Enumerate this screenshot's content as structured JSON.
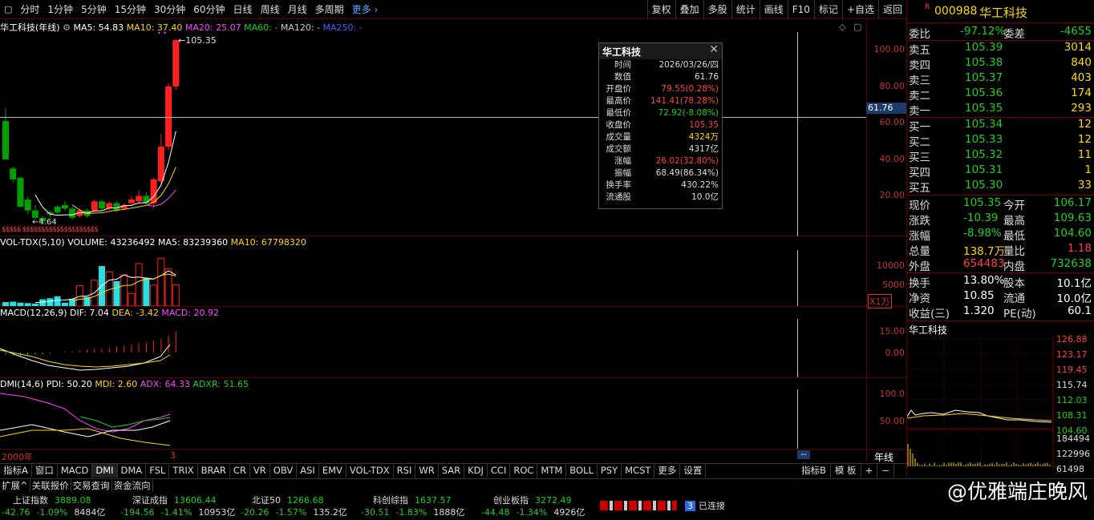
{
  "toolbar": {
    "menu_icon": "square-icon",
    "periods": [
      "分时",
      "1分钟",
      "5分钟",
      "15分钟",
      "30分钟",
      "60分钟",
      "日线",
      "周线",
      "月线",
      "多周期"
    ],
    "more_label": "更多",
    "tools": [
      "复权",
      "叠加",
      "多股",
      "统计",
      "画线",
      "F10",
      "标记",
      "+自选",
      "返回"
    ]
  },
  "price_panel": {
    "title": "华工科技(年线)",
    "ma5": "MA5: 54.83",
    "ma10": "MA10: 37.40",
    "ma20": "MA20: 25.07",
    "ma60": "MA60: -",
    "ma120": "MA120: -",
    "ma250": "MA250: -",
    "high_label": "105.35",
    "low_label": "4.64",
    "cursor_value": "61.76",
    "yticks": [
      "100.00",
      "80.00",
      "60.00",
      "40.00",
      "20.00"
    ],
    "dollar_marks": "$$$$$  $$$$$$$$$$$$$$$$$$$$"
  },
  "vol_panel": {
    "title": "VOL-TDX(5,10)",
    "volume": "VOLUME: 43236492",
    "ma5": "MA5: 83239360",
    "ma10": "MA10: 67798320",
    "yticks": [
      "10000",
      "5000"
    ],
    "unit": "X1万"
  },
  "macd_panel": {
    "title": "MACD(12,26,9)",
    "dif": "DIF: 7.04",
    "dea": "DEA: -3.42",
    "macd": "MACD: 20.92",
    "yticks": [
      "15.00",
      "0.00"
    ]
  },
  "dmi_panel": {
    "title": "DMI(14,6)",
    "pdi": "PDI: 50.20",
    "mdi": "MDI: 2.60",
    "adx": "ADX: 64.33",
    "adxr": "ADXR: 51.65",
    "yticks": [
      "100.0",
      "50.00"
    ]
  },
  "x_axis": {
    "start": "2000年",
    "mark": "3",
    "cursor": "--",
    "period_label": "年线"
  },
  "popup": {
    "title": "华工科技",
    "rows": [
      {
        "k": "时间",
        "v": "2026/03/26/四",
        "c": "#ddd"
      },
      {
        "k": "数值",
        "v": "61.76",
        "c": "#ddd"
      },
      {
        "k": "开盘价",
        "v": "79.55(0.28%)",
        "c": "#ff4040"
      },
      {
        "k": "最高价",
        "v": "141.41(78.28%)",
        "c": "#ff4040"
      },
      {
        "k": "最低价",
        "v": "72.92(-8.08%)",
        "c": "#1ed11e"
      },
      {
        "k": "收盘价",
        "v": "105.35",
        "c": "#ff4040"
      },
      {
        "k": "成交量",
        "v": "4324万",
        "c": "#ffd800"
      },
      {
        "k": "成交额",
        "v": "4317亿",
        "c": "#ddd"
      },
      {
        "k": "涨幅",
        "v": "26.02(32.80%)",
        "c": "#ff4040"
      },
      {
        "k": "振幅",
        "v": "68.49(86.34%)",
        "c": "#ddd"
      },
      {
        "k": "换手率",
        "v": "430.22%",
        "c": "#ddd"
      },
      {
        "k": "流通股",
        "v": "10.0亿",
        "c": "#ddd"
      }
    ]
  },
  "indicator_tabs": [
    "指标A",
    "窗口",
    "MACD",
    "DMI",
    "DMA",
    "FSL",
    "TRIX",
    "BRAR",
    "CR",
    "VR",
    "OBV",
    "ASI",
    "EMV",
    "VOL-TDX",
    "RSI",
    "WR",
    "SAR",
    "KDJ",
    "CCI",
    "ROC",
    "MTM",
    "BOLL",
    "PSY",
    "MCST",
    "更多",
    "设置"
  ],
  "right_tabs": [
    "指标B",
    "模 板",
    "+",
    "−"
  ],
  "sub_tabs": [
    "扩展^",
    "关联报价",
    "交易查询",
    "资金流向"
  ],
  "indices": [
    {
      "name": "上证指数",
      "value": "3889.08",
      "chg": "-42.76",
      "pct": "-1.09%",
      "amt": "8484亿"
    },
    {
      "name": "深证成指",
      "value": "13606.44",
      "chg": "-194.56",
      "pct": "-1.41%",
      "amt": "10953亿"
    },
    {
      "name": "北证50",
      "value": "1266.68",
      "chg": "-20.26",
      "pct": "-1.57%",
      "amt": "135.2亿"
    },
    {
      "name": "科创综指",
      "value": "1637.57",
      "chg": "-30.51",
      "pct": "-1.83%",
      "amt": "1888亿"
    },
    {
      "name": "创业板指",
      "value": "3272.49",
      "chg": "-44.48",
      "pct": "-1.34%",
      "amt": "4926亿"
    }
  ],
  "connection": {
    "num": "3",
    "label": "已连接"
  },
  "watermark": "@优雅端庄晚风",
  "quote": {
    "badge": "R",
    "code": "000988",
    "name": "华工科技",
    "weibi_label": "委比",
    "weibi": "-97.12%",
    "weicha_label": "委差",
    "weicha": "-4655",
    "asks": [
      {
        "label": "卖五",
        "price": "105.39",
        "vol": "3014"
      },
      {
        "label": "卖四",
        "price": "105.38",
        "vol": "840"
      },
      {
        "label": "卖三",
        "price": "105.37",
        "vol": "403"
      },
      {
        "label": "卖二",
        "price": "105.36",
        "vol": "174"
      },
      {
        "label": "卖一",
        "price": "105.35",
        "vol": "293"
      }
    ],
    "bids": [
      {
        "label": "买一",
        "price": "105.34",
        "vol": "12"
      },
      {
        "label": "买二",
        "price": "105.33",
        "vol": "12"
      },
      {
        "label": "买三",
        "price": "105.32",
        "vol": "11"
      },
      {
        "label": "买四",
        "price": "105.31",
        "vol": "1"
      },
      {
        "label": "买五",
        "price": "105.30",
        "vol": "33"
      }
    ],
    "stats": [
      {
        "l1": "现价",
        "v1": "105.35",
        "c1": "#1ed11e",
        "l2": "今开",
        "v2": "106.17",
        "c2": "#1ed11e"
      },
      {
        "l1": "涨跌",
        "v1": "-10.39",
        "c1": "#1ed11e",
        "l2": "最高",
        "v2": "109.63",
        "c2": "#1ed11e"
      },
      {
        "l1": "涨幅",
        "v1": "-8.98%",
        "c1": "#1ed11e",
        "l2": "最低",
        "v2": "104.60",
        "c2": "#1ed11e"
      },
      {
        "l1": "总量",
        "v1": "138.7万",
        "c1": "#ffd800",
        "l2": "量比",
        "v2": "1.18",
        "c2": "#ff4040"
      },
      {
        "l1": "外盘",
        "v1": "654483",
        "c1": "#ff4040",
        "l2": "内盘",
        "v2": "732638",
        "c2": "#1ed11e"
      }
    ],
    "stats2": [
      {
        "l1": "换手",
        "v1": "13.80%",
        "l2": "股本",
        "v2": "10.1亿"
      },
      {
        "l1": "净资",
        "v1": "10.85",
        "l2": "流通",
        "v2": "10.0亿"
      },
      {
        "l1": "收益(三)",
        "v1": "1.320",
        "l2": "PE(动)",
        "v2": "60.1"
      }
    ],
    "mini_title": "华工科技",
    "mini_yticks": [
      {
        "v": "126.88",
        "c": "#ff4040"
      },
      {
        "v": "123.17",
        "c": "#ff4040"
      },
      {
        "v": "119.45",
        "c": "#ff4040"
      },
      {
        "v": "115.74",
        "c": "#ddd"
      },
      {
        "v": "112.03",
        "c": "#1ed11e"
      },
      {
        "v": "108.31",
        "c": "#1ed11e"
      },
      {
        "v": "104.60",
        "c": "#1ed11e"
      }
    ],
    "mini_vol": [
      "184494",
      "122996",
      "61498"
    ]
  },
  "chart_data": {
    "type": "candlestick",
    "candles": [
      {
        "o": 61,
        "h": 68,
        "l": 40,
        "c": 40
      },
      {
        "o": 35,
        "h": 36,
        "l": 27,
        "c": 29
      },
      {
        "o": 30,
        "h": 30,
        "l": 14,
        "c": 14
      },
      {
        "o": 18,
        "h": 20,
        "l": 10,
        "c": 12
      },
      {
        "o": 12,
        "h": 15,
        "l": 7,
        "c": 8
      },
      {
        "o": 8,
        "h": 9,
        "l": 4.64,
        "c": 6
      },
      {
        "o": 11,
        "h": 12,
        "l": 8,
        "c": 10
      },
      {
        "o": 14,
        "h": 15,
        "l": 10,
        "c": 11
      },
      {
        "o": 15,
        "h": 17,
        "l": 12,
        "c": 13
      },
      {
        "o": 13,
        "h": 14,
        "l": 7,
        "c": 8
      },
      {
        "o": 9,
        "h": 13,
        "l": 8,
        "c": 12
      },
      {
        "o": 12,
        "h": 13,
        "l": 8,
        "c": 9
      },
      {
        "o": 12,
        "h": 18,
        "l": 11,
        "c": 17
      },
      {
        "o": 17,
        "h": 18,
        "l": 12,
        "c": 13
      },
      {
        "o": 13,
        "h": 17,
        "l": 12,
        "c": 16
      },
      {
        "o": 16,
        "h": 17,
        "l": 11,
        "c": 12
      },
      {
        "o": 13,
        "h": 16,
        "l": 12,
        "c": 15
      },
      {
        "o": 16,
        "h": 20,
        "l": 15,
        "c": 18
      },
      {
        "o": 17,
        "h": 23,
        "l": 16,
        "c": 20
      },
      {
        "o": 20,
        "h": 22,
        "l": 15,
        "c": 16
      },
      {
        "o": 16,
        "h": 30,
        "l": 13,
        "c": 29
      },
      {
        "o": 28,
        "h": 54,
        "l": 25,
        "c": 47
      },
      {
        "o": 47,
        "h": 82,
        "l": 45,
        "c": 80
      },
      {
        "o": 80,
        "h": 106,
        "l": 78,
        "c": 105.35
      }
    ],
    "volume": [
      800,
      900,
      700,
      600,
      500,
      1400,
      1600,
      2000,
      700,
      1500,
      4200,
      1900,
      5300,
      8200,
      7000,
      5100,
      6400,
      2600,
      8700,
      5800,
      4300,
      9800,
      7600,
      4324
    ],
    "ylim": [
      0,
      112
    ]
  }
}
